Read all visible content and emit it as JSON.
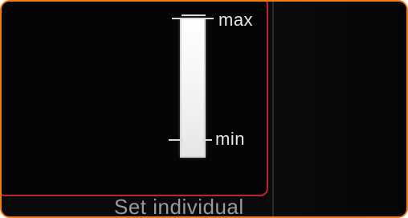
{
  "scale": {
    "max_label": "max",
    "min_label": "min",
    "level_fraction": 1.0
  },
  "footer": {
    "caption": "Set individual"
  },
  "colors": {
    "outer_border": "#f07d1a",
    "panel_border": "#c0242a",
    "background": "#0a0a0a",
    "text": "#e6e6e6"
  }
}
